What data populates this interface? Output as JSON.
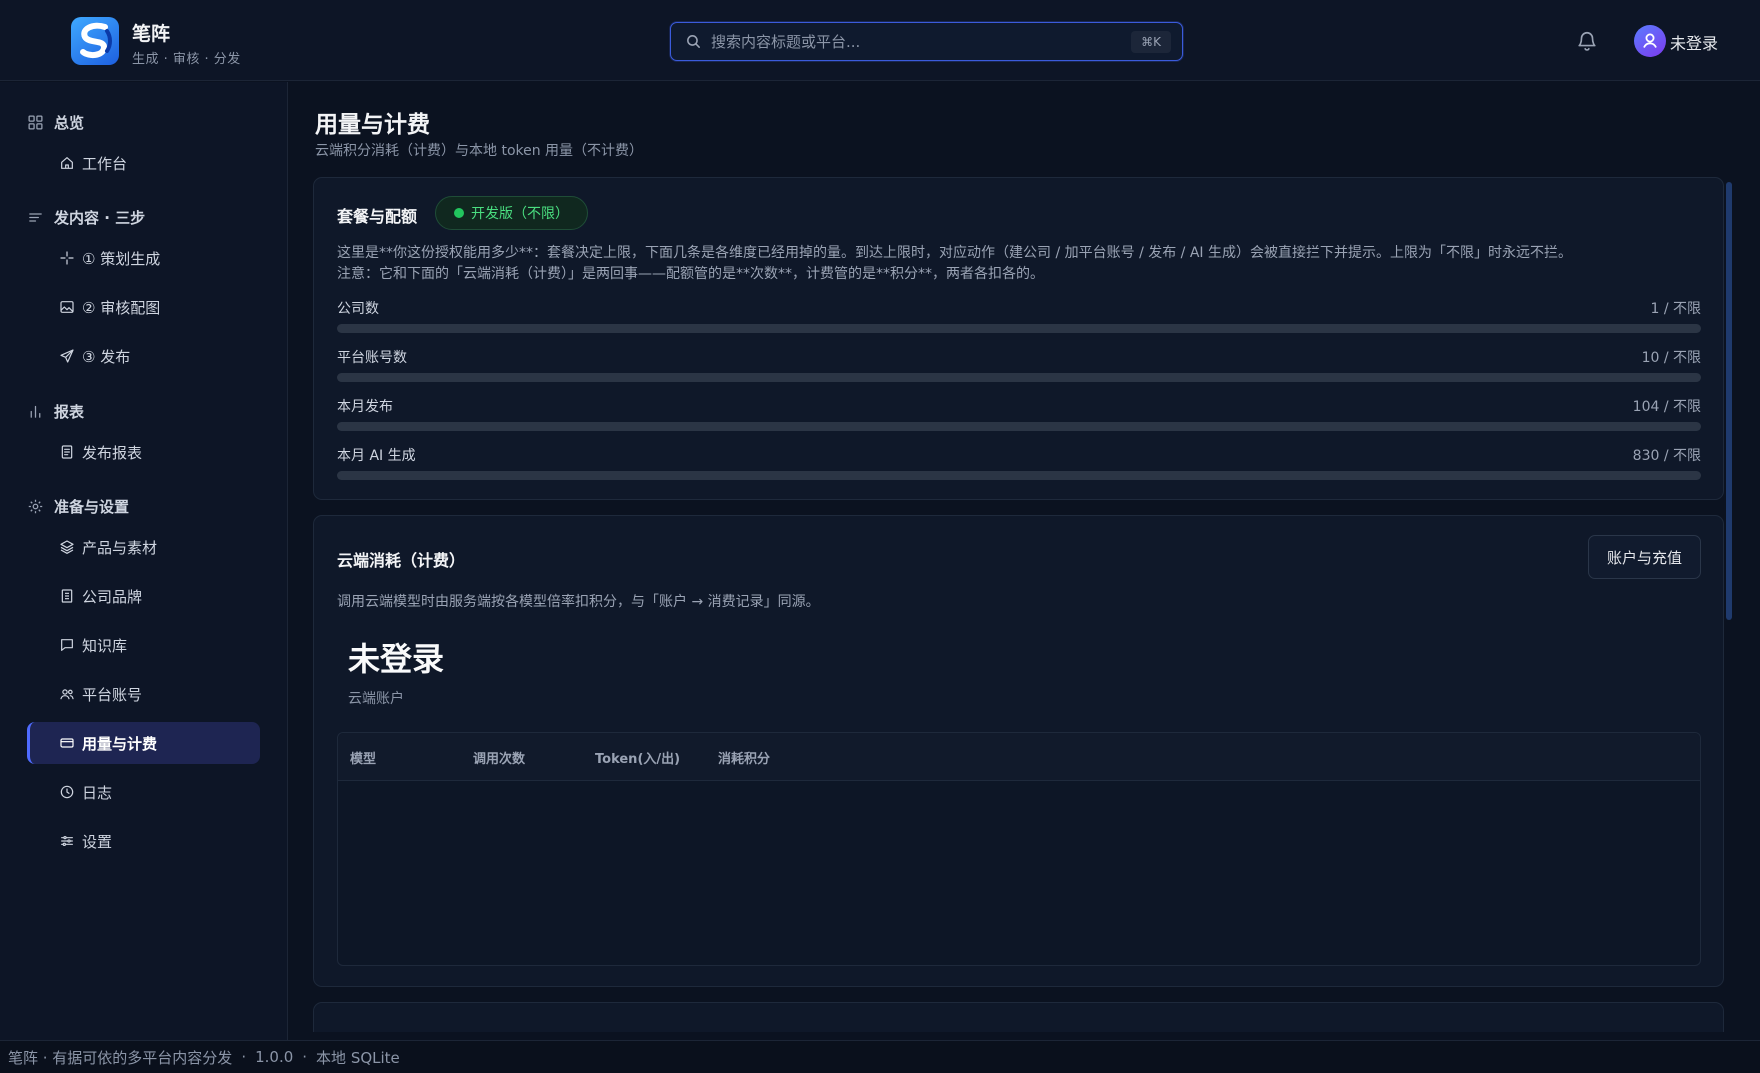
{
  "app": {
    "name": "笔阵",
    "tagline": "生成 · 审核 · 分发"
  },
  "search": {
    "placeholder": "搜索内容标题或平台...",
    "value": "",
    "shortcut": "⌘K"
  },
  "user": {
    "label": "未登录"
  },
  "sidebar": {
    "groups": [
      {
        "title": "总览",
        "icon": "grid-icon",
        "items": [
          {
            "label": "工作台",
            "icon": "home-icon"
          }
        ]
      },
      {
        "title": "发内容 · 三步",
        "icon": "list-icon",
        "items": [
          {
            "label": "① 策划生成",
            "icon": "sparkle-icon"
          },
          {
            "label": "② 审核配图",
            "icon": "image-icon"
          },
          {
            "label": "③ 发布",
            "icon": "send-icon"
          }
        ]
      },
      {
        "title": "报表",
        "icon": "bar-chart-icon",
        "items": [
          {
            "label": "发布报表",
            "icon": "document-icon"
          }
        ]
      },
      {
        "title": "准备与设置",
        "icon": "gear-icon",
        "items": [
          {
            "label": "产品与素材",
            "icon": "layers-icon"
          },
          {
            "label": "公司品牌",
            "icon": "building-icon"
          },
          {
            "label": "知识库",
            "icon": "message-square-icon"
          },
          {
            "label": "平台账号",
            "icon": "users-icon"
          },
          {
            "label": "用量与计费",
            "icon": "credit-card-icon",
            "active": true
          },
          {
            "label": "日志",
            "icon": "clock-icon"
          },
          {
            "label": "设置",
            "icon": "sliders-icon"
          }
        ]
      }
    ]
  },
  "page": {
    "title": "用量与计费",
    "subtitle": "云端积分消耗（计费）与本地 token 用量（不计费）"
  },
  "plan_card": {
    "title": "套餐与配额",
    "badge": "开发版（不限）",
    "badge_color": "#22c55e",
    "desc_line1": "这里是**你这份授权能用多少**：套餐决定上限，下面几条是各维度已经用掉的量。到达上限时，对应动作（建公司 / 加平台账号 / 发布 / AI 生成）会被直接拦下并提示。上限为「不限」时永远不拦。",
    "desc_line2": "注意：它和下面的「云端消耗（计费）」是两回事——配额管的是**次数**，计费管的是**积分**，两者各扣各的。",
    "quotas": [
      {
        "label": "公司数",
        "value": "1 / 不限",
        "fill": 0
      },
      {
        "label": "平台账号数",
        "value": "10 / 不限",
        "fill": 0
      },
      {
        "label": "本月发布",
        "value": "104 / 不限",
        "fill": 0
      },
      {
        "label": "本月 AI 生成",
        "value": "830 / 不限",
        "fill": 0
      }
    ]
  },
  "cloud_card": {
    "title": "云端消耗（计费）",
    "button": "账户与充值",
    "desc": "调用云端模型时由服务端按各模型倍率扣积分，与「账户 → 消费记录」同源。",
    "status": "未登录",
    "status_sub": "云端账户",
    "table_headers": [
      "模型",
      "调用次数",
      "Token(入/出)",
      "消耗积分"
    ],
    "rows": []
  },
  "footer": {
    "product": "笔阵 · 有据可依的多平台内容分发",
    "version": "1.0.0",
    "storage": "本地 SQLite"
  },
  "colors": {
    "accent": "#4f6bff",
    "background": "#0b1220",
    "success": "#22c55e"
  }
}
